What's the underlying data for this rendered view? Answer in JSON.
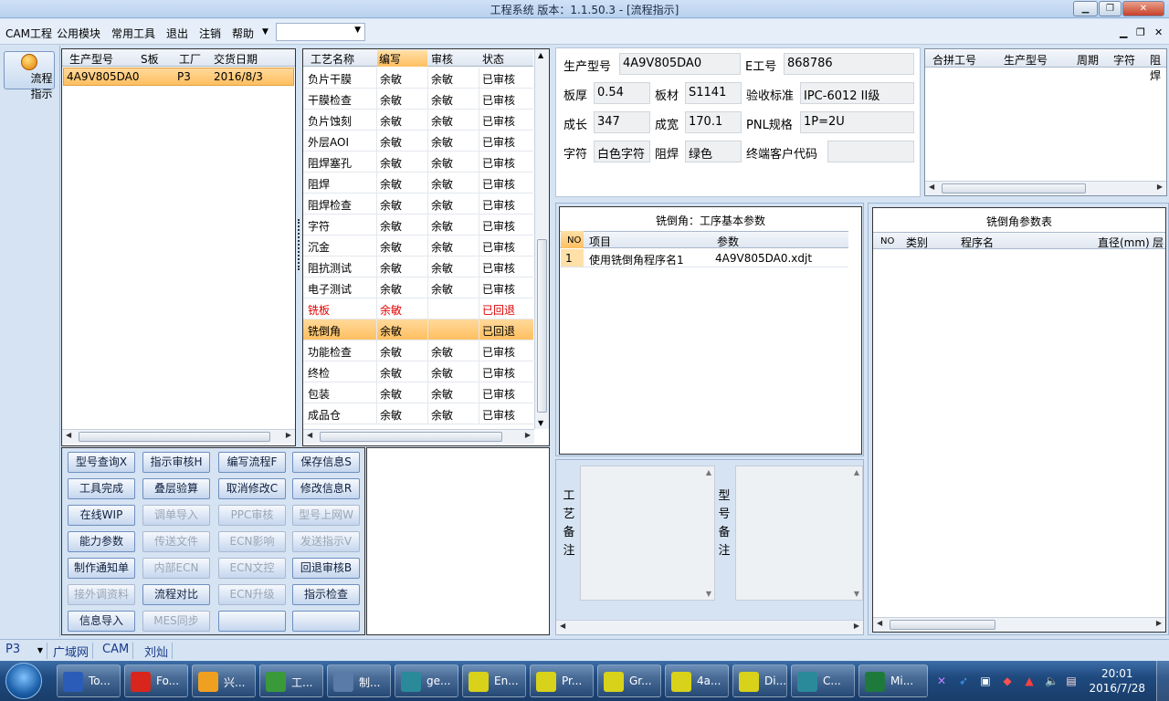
{
  "window": {
    "title": "工程系统   版本：1.1.50.3 - [流程指示]"
  },
  "menubar": {
    "items": [
      "CAM工程",
      "公用模块",
      "常用工具",
      "退出",
      "注销",
      "帮助"
    ],
    "combo_value": ""
  },
  "left_strip": {
    "flow_button_label": "流程指示"
  },
  "model_table": {
    "columns": [
      "生产型号",
      "S板",
      "工厂",
      "交货日期"
    ],
    "rows": [
      {
        "model": "4A9V805DA0",
        "s_board": "",
        "factory": "P3",
        "date": "2016/8/3"
      }
    ]
  },
  "process_table": {
    "columns": [
      "工艺名称",
      "编写",
      "审核",
      "状态"
    ],
    "rows": [
      {
        "name": "负片干膜",
        "writer": "余敏",
        "reviewer": "余敏",
        "status": "已审核",
        "highlight": "none"
      },
      {
        "name": "干膜检查",
        "writer": "余敏",
        "reviewer": "余敏",
        "status": "已审核",
        "highlight": "none"
      },
      {
        "name": "负片蚀刻",
        "writer": "余敏",
        "reviewer": "余敏",
        "status": "已审核",
        "highlight": "none"
      },
      {
        "name": "外层AOI",
        "writer": "余敏",
        "reviewer": "余敏",
        "status": "已审核",
        "highlight": "none"
      },
      {
        "name": "阻焊塞孔",
        "writer": "余敏",
        "reviewer": "余敏",
        "status": "已审核",
        "highlight": "none"
      },
      {
        "name": "阻焊",
        "writer": "余敏",
        "reviewer": "余敏",
        "status": "已审核",
        "highlight": "none"
      },
      {
        "name": "阻焊检查",
        "writer": "余敏",
        "reviewer": "余敏",
        "status": "已审核",
        "highlight": "none"
      },
      {
        "name": "字符",
        "writer": "余敏",
        "reviewer": "余敏",
        "status": "已审核",
        "highlight": "none"
      },
      {
        "name": "沉金",
        "writer": "余敏",
        "reviewer": "余敏",
        "status": "已审核",
        "highlight": "none"
      },
      {
        "name": "阻抗测试",
        "writer": "余敏",
        "reviewer": "余敏",
        "status": "已审核",
        "highlight": "none"
      },
      {
        "name": "电子测试",
        "writer": "余敏",
        "reviewer": "余敏",
        "status": "已审核",
        "highlight": "none"
      },
      {
        "name": "铣板",
        "writer": "余敏",
        "reviewer": "",
        "status": "已回退",
        "highlight": "red"
      },
      {
        "name": "铣倒角",
        "writer": "余敏",
        "reviewer": "",
        "status": "已回退",
        "highlight": "selected"
      },
      {
        "name": "功能检查",
        "writer": "余敏",
        "reviewer": "余敏",
        "status": "已审核",
        "highlight": "none"
      },
      {
        "name": "终检",
        "writer": "余敏",
        "reviewer": "余敏",
        "status": "已审核",
        "highlight": "none"
      },
      {
        "name": "包装",
        "writer": "余敏",
        "reviewer": "余敏",
        "status": "已审核",
        "highlight": "none"
      },
      {
        "name": "成品仓",
        "writer": "余敏",
        "reviewer": "余敏",
        "status": "已审核",
        "highlight": "none"
      }
    ]
  },
  "action_buttons": [
    {
      "label": "型号查询X",
      "enabled": true
    },
    {
      "label": "指示审核H",
      "enabled": true
    },
    {
      "label": "编写流程F",
      "enabled": true
    },
    {
      "label": "保存信息S",
      "enabled": true
    },
    {
      "label": "工具完成",
      "enabled": true
    },
    {
      "label": "叠层验算",
      "enabled": true
    },
    {
      "label": "取消修改C",
      "enabled": true
    },
    {
      "label": "修改信息R",
      "enabled": true
    },
    {
      "label": "在线WIP",
      "enabled": true
    },
    {
      "label": "调单导入",
      "enabled": false
    },
    {
      "label": "PPC审核",
      "enabled": false
    },
    {
      "label": "型号上网W",
      "enabled": false
    },
    {
      "label": "能力参数",
      "enabled": true
    },
    {
      "label": "传送文件",
      "enabled": false
    },
    {
      "label": "ECN影响",
      "enabled": false
    },
    {
      "label": "发送指示V",
      "enabled": false
    },
    {
      "label": "制作通知单",
      "enabled": true
    },
    {
      "label": "内部ECN",
      "enabled": false
    },
    {
      "label": "ECN文控",
      "enabled": false
    },
    {
      "label": "回退审核B",
      "enabled": true
    },
    {
      "label": "接外调资料",
      "enabled": false
    },
    {
      "label": "流程对比",
      "enabled": true
    },
    {
      "label": "ECN升级",
      "enabled": false
    },
    {
      "label": "指示检查",
      "enabled": true
    },
    {
      "label": "信息导入",
      "enabled": true
    },
    {
      "label": "MES同步",
      "enabled": false
    },
    {
      "label": "",
      "enabled": true
    },
    {
      "label": "",
      "enabled": true
    }
  ],
  "info": {
    "model_label": "生产型号",
    "model_value": "4A9V805DA0",
    "eno_label": "E工号",
    "eno_value": "868786",
    "thickness_label": "板厚",
    "thickness_value": "0.54",
    "material_label": "板材",
    "material_value": "S1141",
    "standard_label": "验收标准",
    "standard_value": "IPC-6012 II级",
    "length_label": "成长",
    "length_value": "347",
    "width_label": "成宽",
    "width_value": "170.1",
    "pnl_label": "PNL规格",
    "pnl_value": "1P=2U",
    "char_label": "字符",
    "char_value": "白色字符",
    "solder_label": "阻焊",
    "solder_value": "绿色",
    "customer_label": "终端客户代码",
    "customer_value": ""
  },
  "merge_table": {
    "columns": [
      "合拼工号",
      "生产型号",
      "周期",
      "字符",
      "阻焊"
    ]
  },
  "basic_params": {
    "title": "铣倒角：工序基本参数",
    "columns": [
      "NO",
      "项目",
      "参数"
    ],
    "rows": [
      {
        "no": "1",
        "item": "使用铣倒角程序名1",
        "param": "4A9V805DA0.xdjt"
      }
    ]
  },
  "param_table": {
    "title": "铣倒角参数表",
    "columns": [
      "NO",
      "类别",
      "程序名",
      "直径(mm)",
      "层"
    ]
  },
  "notes": {
    "process_label": "工艺备注",
    "model_label": "型号备注"
  },
  "statusbar": {
    "factory": "P3",
    "network": "广域网",
    "dept": "CAM",
    "user": "刘灿"
  },
  "taskbar": {
    "items": [
      {
        "label": "To...",
        "color": "#2b5cb8"
      },
      {
        "label": "Fo...",
        "color": "#d8261c"
      },
      {
        "label": "兴...",
        "color": "#f0a020"
      },
      {
        "label": "工...",
        "color": "#3a9a3a"
      },
      {
        "label": "制...",
        "color": "#5a7aa8"
      },
      {
        "label": "ge...",
        "color": "#2a8a9a"
      },
      {
        "label": "En...",
        "color": "#d9d21a"
      },
      {
        "label": "Pr...",
        "color": "#d9d21a"
      },
      {
        "label": "Gr...",
        "color": "#d9d21a"
      },
      {
        "label": "4a...",
        "color": "#d9d21a"
      },
      {
        "label": "Di...",
        "color": "#d9d21a"
      },
      {
        "label": "C...",
        "color": "#2a8a9a"
      },
      {
        "label": "Mi...",
        "color": "#1e7a3c"
      }
    ],
    "time": "20:01",
    "date": "2016/7/28"
  }
}
